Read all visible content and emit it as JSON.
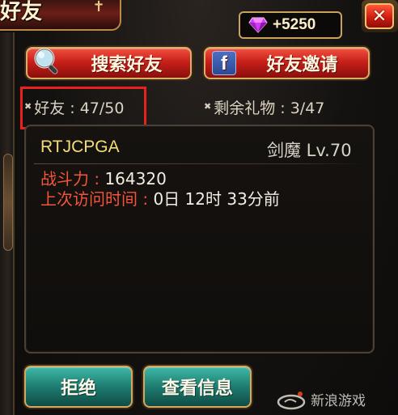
{
  "window": {
    "title": "好友",
    "close_label": "✕"
  },
  "currency": {
    "gem_value": "+5250"
  },
  "actions": {
    "search_label": "搜索好友",
    "invite_label": "好友邀请",
    "invite_icon_letter": "f"
  },
  "stats": {
    "friends": "好友 : 47/50",
    "gifts": "剩余礼物 : 3/47"
  },
  "friend_request": {
    "name": "RTJCPGA",
    "class_level": "剑魔 Lv.70",
    "power_label": "战斗力 : ",
    "power_value": "164320",
    "visit_label": "上次访问时间 : ",
    "visit_value": "0日 12时 33分前"
  },
  "footer": {
    "reject_label": "拒绝",
    "view_label": "查看信息"
  },
  "watermark": {
    "text": "新浪游戏"
  },
  "colors": {
    "red_button": "#c8201a",
    "teal_button": "#1e7c70",
    "gold_border": "#d9b06a",
    "name_yellow": "#f5dc7a",
    "label_red": "#f2553a",
    "highlight_red": "#e8211c"
  },
  "icons": {
    "title_pin": "pin-icon",
    "close": "close-icon",
    "gem": "gem-icon",
    "search": "magnifier-icon",
    "invite": "facebook-icon",
    "stat_marker": "star-icon",
    "watermark_logo": "sina-logo"
  }
}
